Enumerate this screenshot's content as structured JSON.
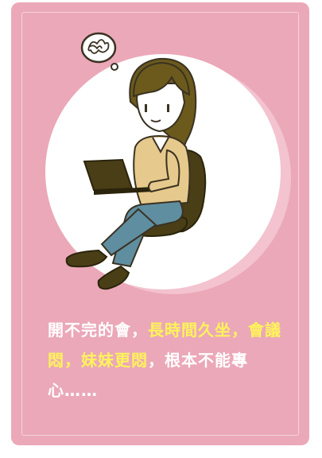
{
  "caption": {
    "part1": "開不完的會，",
    "part2": "長時間久坐，",
    "part3": "會議悶，妹妹更悶",
    "part4": "，根本不能專心……"
  },
  "colors": {
    "card": "#eba8b8",
    "highlight": "#fff35a",
    "text": "#ffffff",
    "circle": "#ffffff",
    "circle_shadow": "#f3c3cf"
  },
  "icons": [
    "scribble-thought-bubble-icon",
    "woman-with-laptop-illustration"
  ]
}
